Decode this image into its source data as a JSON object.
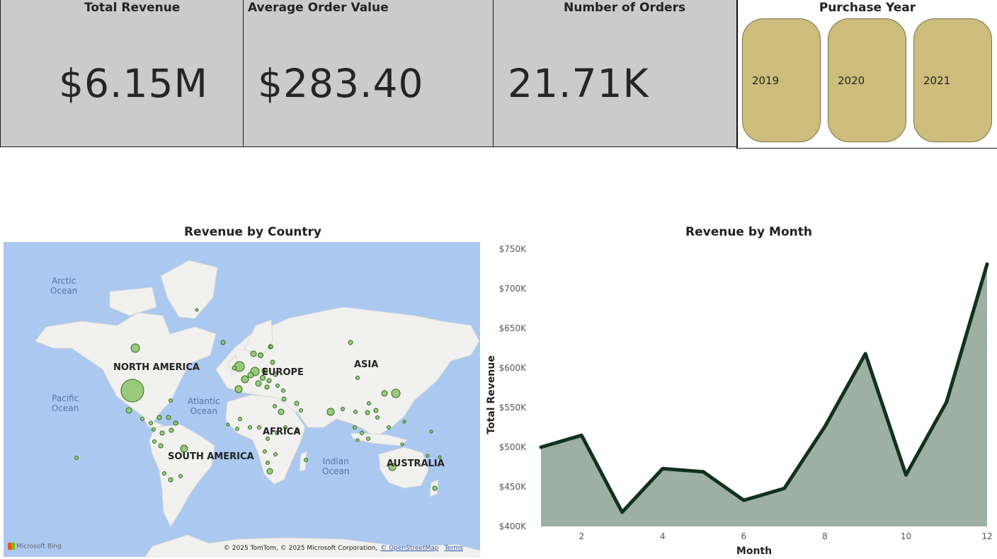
{
  "kpis": {
    "total_revenue": {
      "title": "Total Revenue",
      "value": "$6.15M"
    },
    "avg_order_value": {
      "title": "Average Order Value",
      "value": "$283.40"
    },
    "num_orders": {
      "title": "Number of Orders",
      "value": "21.71K"
    }
  },
  "slicer": {
    "title": "Purchase Year",
    "years": [
      "2019",
      "2020",
      "2021"
    ]
  },
  "map": {
    "title": "Revenue by Country",
    "continents": {
      "north_america": "NORTH AMERICA",
      "south_america": "SOUTH AMERICA",
      "europe": "EUROPE",
      "africa": "AFRICA",
      "asia": "ASIA",
      "australia": "AUSTRALIA"
    },
    "oceans": {
      "arctic": [
        "Arctic",
        "Ocean"
      ],
      "pacific": [
        "Pacific",
        "Ocean"
      ],
      "atlantic": [
        "Atlantic",
        "Ocean"
      ],
      "indian": [
        "Indian",
        "Ocean"
      ]
    },
    "attribution": "© 2025 TomTom, © 2025 Microsoft Corporation,",
    "osm_link": "© OpenStreetMap",
    "terms_link": "Terms",
    "logo_text": "Microsoft Bing",
    "colors": {
      "water": "#abc8f0",
      "land": "#f1f1ef",
      "bubble": "#8fc56f",
      "bubble_stroke": "#2e6b1e"
    }
  },
  "chart_data": {
    "type": "area",
    "title": "Revenue by Month",
    "xlabel": "Month",
    "ylabel": "Total Revenue",
    "x": [
      1,
      2,
      3,
      4,
      5,
      6,
      7,
      8,
      9,
      10,
      11,
      12
    ],
    "values": [
      500000,
      515000,
      418000,
      473000,
      469000,
      433000,
      448000,
      526000,
      618000,
      465000,
      557000,
      731000
    ],
    "x_ticks": [
      2,
      4,
      6,
      8,
      10,
      12
    ],
    "y_ticks": [
      400000,
      450000,
      500000,
      550000,
      600000,
      650000,
      700000,
      750000
    ],
    "y_tick_labels": [
      "$400K",
      "$450K",
      "$500K",
      "$550K",
      "$600K",
      "$650K",
      "$700K",
      "$750K"
    ],
    "ylim": [
      400000,
      750000
    ],
    "xlim": [
      1,
      12
    ],
    "grid": false,
    "colors": {
      "line": "#10321f",
      "fill": "#9eafa3"
    }
  }
}
